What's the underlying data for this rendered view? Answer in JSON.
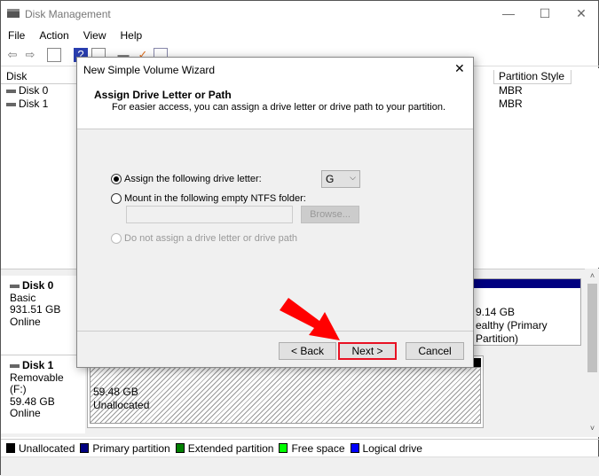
{
  "window": {
    "title": "Disk Management",
    "minimize": "—",
    "maximize": "☐",
    "close": "✕"
  },
  "menu": [
    "File",
    "Action",
    "View",
    "Help"
  ],
  "list": {
    "col_disk": "Disk",
    "col_partition_style": "Partition Style",
    "rows": [
      {
        "disk": "Disk 0",
        "style": "MBR"
      },
      {
        "disk": "Disk 1",
        "style": "MBR"
      }
    ]
  },
  "disks": [
    {
      "name": "Disk 0",
      "type": "Basic",
      "size": "931.51 GB",
      "status": "Online",
      "partition_size": "9.14 GB",
      "partition_status": "ealthy (Primary Partition)"
    },
    {
      "name": "Disk 1",
      "type": "Removable (F:)",
      "size": "59.48 GB",
      "status": "Online",
      "partition_size": "59.48 GB",
      "partition_status": "Unallocated"
    }
  ],
  "legend": [
    {
      "label": "Unallocated",
      "color": "#000000"
    },
    {
      "label": "Primary partition",
      "color": "#000080"
    },
    {
      "label": "Extended partition",
      "color": "#008000"
    },
    {
      "label": "Free space",
      "color": "#00ff00"
    },
    {
      "label": "Logical drive",
      "color": "#0000ff"
    }
  ],
  "dialog": {
    "title": "New Simple Volume Wizard",
    "close": "✕",
    "heading": "Assign Drive Letter or Path",
    "subheading": "For easier access, you can assign a drive letter or drive path to your partition.",
    "option_assign": "Assign the following drive letter:",
    "drive_letter": "G",
    "option_mount": "Mount in the following empty NTFS folder:",
    "folder_value": "",
    "browse": "Browse...",
    "option_none": "Do not assign a drive letter or drive path",
    "back": "< Back",
    "next": "Next >",
    "cancel": "Cancel",
    "selected_option": "assign"
  },
  "colors": {
    "highlight": "#e81123",
    "arrow": "#ff0000"
  }
}
